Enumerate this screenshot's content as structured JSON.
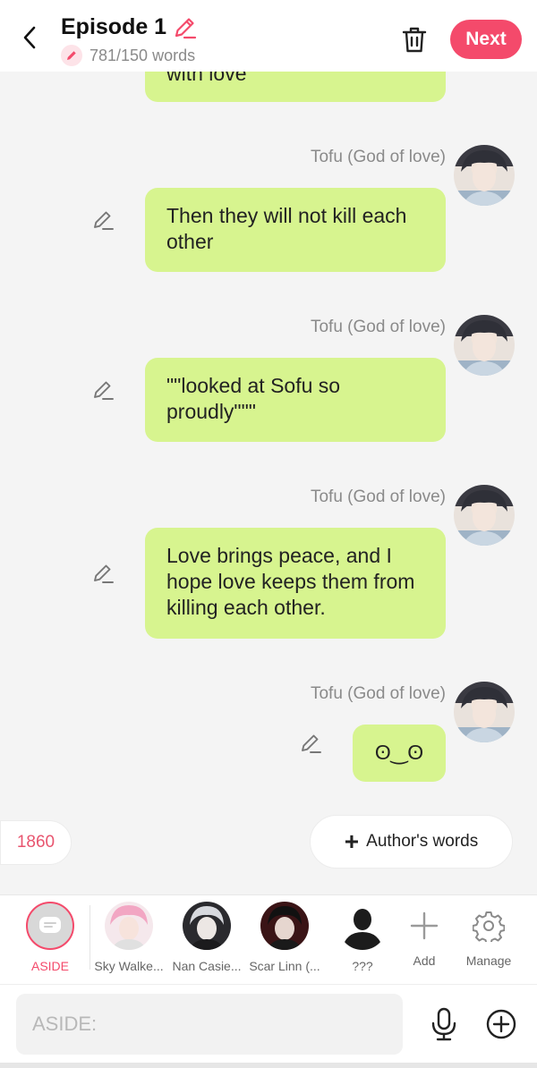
{
  "header": {
    "title": "Episode 1",
    "word_count": "781/150 words",
    "next_label": "Next"
  },
  "messages": [
    {
      "speaker": "",
      "text": "with love"
    },
    {
      "speaker": "Tofu (God of love)",
      "text": "Then they will not kill each other"
    },
    {
      "speaker": "Tofu (God of love)",
      "text": "\"\"looked at Sofu so proudly\"\"\""
    },
    {
      "speaker": "Tofu (God of love)",
      "text": "Love brings peace, and I hope love keeps them from killing each other."
    },
    {
      "speaker": "Tofu (God of love)",
      "text": "ʘ‿ʘ"
    }
  ],
  "count_chip": "1860",
  "author_words_label": "Author's words",
  "characters": [
    {
      "name": "ASIDE",
      "selected": true
    },
    {
      "name": "Sky Walke..."
    },
    {
      "name": "Nan Casie..."
    },
    {
      "name": "Scar Linn (..."
    },
    {
      "name": "???"
    },
    {
      "name": "Add"
    },
    {
      "name": "Manage"
    }
  ],
  "input": {
    "placeholder": "ASIDE:"
  },
  "colors": {
    "accent": "#f44a6b",
    "bubble": "#d7f48f"
  },
  "icons": [
    "back-arrow-icon",
    "pencil-icon",
    "trash-icon",
    "edit-icon",
    "aside-icon",
    "add-icon",
    "gear-icon",
    "mic-icon",
    "plus-circle-icon"
  ]
}
